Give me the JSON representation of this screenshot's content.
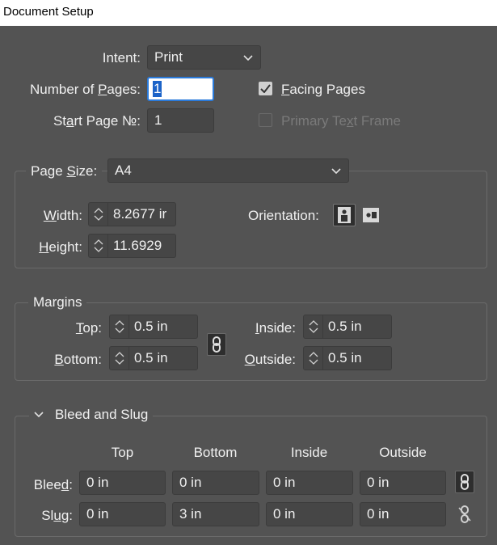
{
  "window": {
    "title": "Document Setup"
  },
  "intent": {
    "label": "Intent:",
    "value": "Print"
  },
  "pages": {
    "label": "Number of Pages:",
    "value": "1"
  },
  "start_page": {
    "label": "Start Page №:",
    "value": "1"
  },
  "facing_pages": {
    "label": "Facing Pages",
    "checked": true
  },
  "primary_text_frame": {
    "label": "Primary Text Frame",
    "checked": false,
    "enabled": false
  },
  "page_size": {
    "label": "Page Size:",
    "value": "A4",
    "width_label": "Width:",
    "width_value": "8.2677 ir",
    "height_label": "Height:",
    "height_value": "11.6929",
    "orientation_label": "Orientation:"
  },
  "margins": {
    "title": "Margins",
    "top_label": "Top:",
    "top_value": "0.5 in",
    "bottom_label": "Bottom:",
    "bottom_value": "0.5 in",
    "inside_label": "Inside:",
    "inside_value": "0.5 in",
    "outside_label": "Outside:",
    "outside_value": "0.5 in"
  },
  "bleed_slug": {
    "title": "Bleed and Slug",
    "headers": [
      "Top",
      "Bottom",
      "Inside",
      "Outside"
    ],
    "bleed_label": "Bleed:",
    "bleed": [
      "0 in",
      "0 in",
      "0 in",
      "0 in"
    ],
    "slug_label": "Slug:",
    "slug": [
      "0 in",
      "3 in",
      "0 in",
      "0 in"
    ]
  }
}
